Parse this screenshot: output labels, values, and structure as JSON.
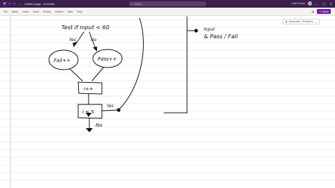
{
  "title_bar": {
    "app_letter": "N",
    "window_title": "Untitled page - OneNote",
    "search_placeholder": "Search",
    "user_name": "Luke Finney",
    "avatar_initials": "LF",
    "window_controls": [
      "—",
      "▢",
      "✕"
    ]
  },
  "ribbon": {
    "menu_items": [
      "File",
      "Home",
      "Insert",
      "Draw",
      "History",
      "Review",
      "View",
      "Help"
    ],
    "share_label": "Share"
  },
  "tag_chip": {
    "label": "Homerade > Problems"
  },
  "handwriting": {
    "test_line": "Test  if  input < 60",
    "yes_left": "Yes",
    "no_left": "No",
    "fail_node": "Fail++",
    "pass_node": "Pass++",
    "increment_node": "i++",
    "loop_condition": "i ≤ 5",
    "yes_right": "Yes",
    "no_bottom": "No",
    "input_note": "Input",
    "result_note": "& Pass / Fail"
  },
  "colors": {
    "title_bar_bg": "#3b1f4f",
    "accent": "#7719aa",
    "rule_line": "#cfe0f5",
    "margin_line": "#f2b8b8"
  }
}
